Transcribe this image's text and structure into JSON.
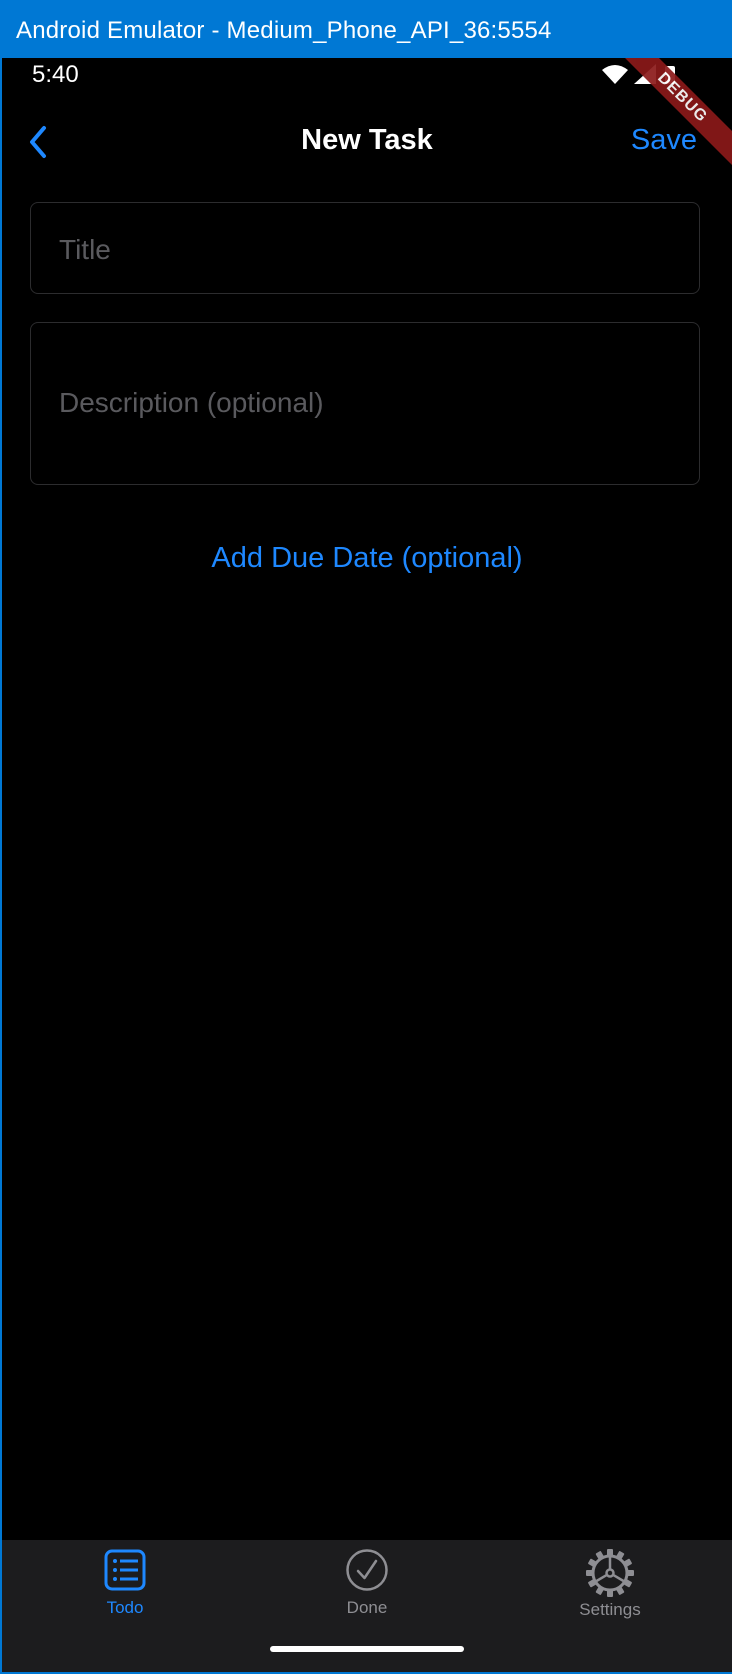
{
  "window": {
    "title": "Android Emulator - Medium_Phone_API_36:5554"
  },
  "status_bar": {
    "time": "5:40",
    "icons": [
      "wifi-icon",
      "signal-icon",
      "battery-icon"
    ],
    "debug_banner": "DEBUG"
  },
  "nav": {
    "back_icon": "chevron-left-icon",
    "title": "New Task",
    "save_label": "Save"
  },
  "form": {
    "title_placeholder": "Title",
    "title_value": "",
    "description_placeholder": "Description (optional)",
    "description_value": "",
    "due_date_label": "Add Due Date (optional)"
  },
  "tab_bar": {
    "tabs": [
      {
        "label": "Todo",
        "icon": "list-icon",
        "active": true
      },
      {
        "label": "Done",
        "icon": "checkmark-circle-icon",
        "active": false
      },
      {
        "label": "Settings",
        "icon": "gear-icon",
        "active": false
      }
    ]
  },
  "colors": {
    "accent": "#1e88ff",
    "background": "#000000",
    "tab_bar_bg": "#1c1c1e",
    "inactive": "#8e8e93",
    "window_chrome": "#0078d4"
  }
}
